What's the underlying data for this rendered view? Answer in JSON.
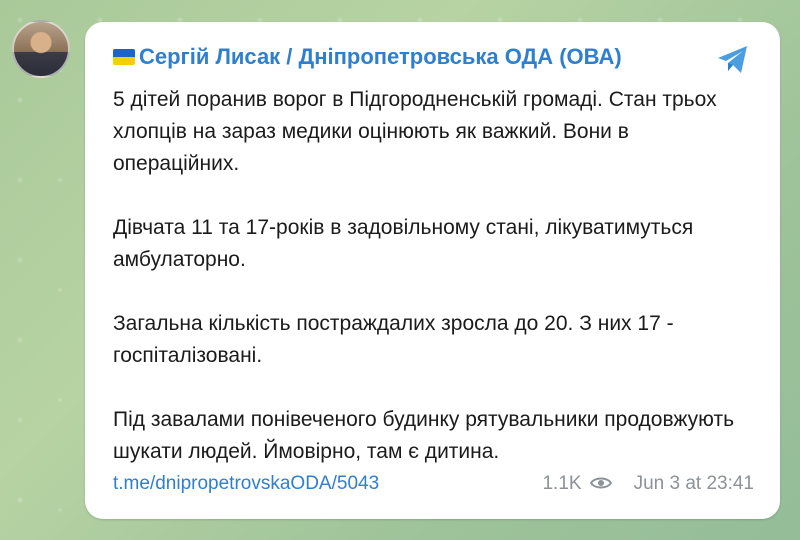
{
  "post": {
    "author": "Сергій Лисак / Дніпропетровська ОДА (ОВА)",
    "paragraphs": [
      "5 дітей поранив ворог в Підгородненській громаді. Стан трьох хлопців на зараз медики оцінюють як важкий. Вони в операційних.",
      "Дівчата 11 та 17-років в задовільному стані, лікуватимуться амбулаторно.",
      "Загальна кількість постраждалих зросла до 20. З них 17 - госпіталізовані.",
      "Під завалами понівеченого будинку рятувальники продовжують шукати людей. Ймовірно, там є дитина."
    ],
    "link": "t.me/dnipropetrovskaODA/5043",
    "views": "1.1K",
    "time": "Jun 3 at 23:41"
  },
  "icons": {
    "share": "telegram-plane-icon",
    "views": "eye-icon",
    "flag": "ukraine-flag-icon"
  },
  "colors": {
    "accent": "#2f7fcf",
    "meta": "#8c9298",
    "background": "#a9c99a"
  }
}
